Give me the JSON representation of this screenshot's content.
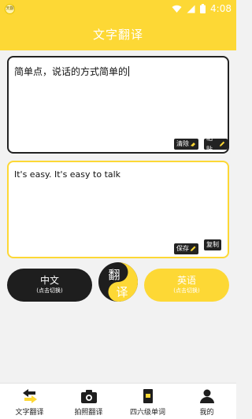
{
  "status_bar": {
    "time": "4:08",
    "app_icon_text": "天翻"
  },
  "header": {
    "title": "文字翻译"
  },
  "source": {
    "text": "简单点，说话的方式简单的",
    "clear_label": "清除",
    "paste_label": "粘贴"
  },
  "target": {
    "text": "It's easy. It's easy to talk",
    "save_label": "保存",
    "copy_label": "复制"
  },
  "language": {
    "source_name": "中文",
    "source_hint": "(点击切换)",
    "target_name": "英语",
    "target_hint": "(点击切换)"
  },
  "translate_button": {
    "top_char": "翻",
    "bottom_char": "译"
  },
  "tabs": [
    {
      "label": "文字翻译",
      "icon": "swap-arrows-icon",
      "active": true
    },
    {
      "label": "拍照翻译",
      "icon": "camera-icon",
      "active": false
    },
    {
      "label": "四六级单词",
      "icon": "word-book-icon",
      "active": false
    },
    {
      "label": "我的",
      "icon": "user-icon",
      "active": false
    }
  ],
  "colors": {
    "accent": "#fdd835",
    "dark": "#1e1e1e",
    "background": "#f2f2f2"
  }
}
